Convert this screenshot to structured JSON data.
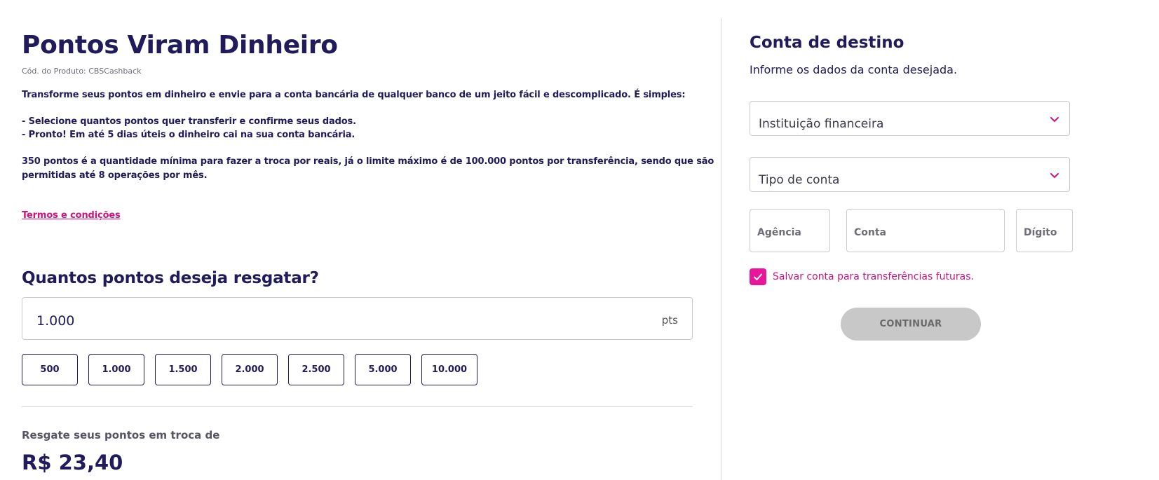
{
  "product": {
    "title": "Pontos Viram Dinheiro",
    "code": "Cód. do Produto: CBSCashback",
    "description": [
      "Transforme seus pontos em dinheiro e envie para a conta bancária de qualquer banco de um jeito fácil e descomplicado. É simples:",
      "- Selecione quantos pontos quer transferir e confirme seus dados.",
      "- Pronto! Em até 5 dias úteis o dinheiro cai na sua conta bancária.",
      "350 pontos é a quantidade mínima para fazer a troca por reais, já o limite máximo é de 100.000 pontos por transferência, sendo que são",
      "permitidas até 8 operações por mês."
    ],
    "terms_link": "Termos e condições"
  },
  "redeem": {
    "question": "Quantos pontos deseja resgatar?",
    "input_value": "1.000",
    "unit": "pts",
    "quick_options": [
      "500",
      "1.000",
      "1.500",
      "2.000",
      "2.500",
      "5.000",
      "10.000"
    ],
    "reward_label": "Resgate seus pontos em troca de",
    "reward_value": "R$ 23,40"
  },
  "destination": {
    "title": "Conta de destino",
    "subtitle": "Informe os dados da conta desejada.",
    "institution_label": "Instituição financeira",
    "account_type_label": "Tipo de conta",
    "agency_placeholder": "Agência",
    "account_placeholder": "Conta",
    "digit_placeholder": "Dígito",
    "save_account_label": "Salvar conta para transferências futuras.",
    "save_account_checked": true,
    "continue_label": "CONTINUAR"
  },
  "colors": {
    "primary": "#211a5b",
    "accent": "#e8169a",
    "link": "#d1127f",
    "disabled_button": "#c8c8c8"
  },
  "icons": {
    "select_chevron": "chevron-down-icon",
    "checkbox_mark": "checkmark-icon"
  }
}
